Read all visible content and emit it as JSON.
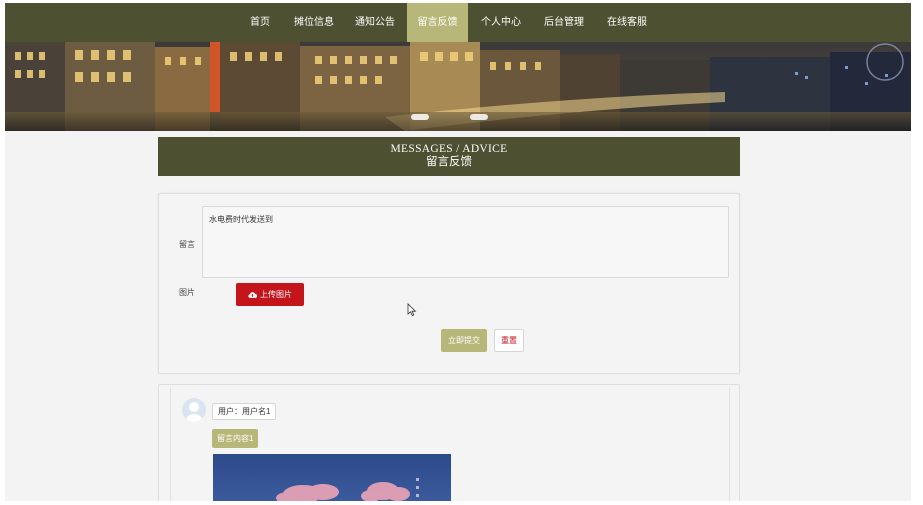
{
  "nav": {
    "items": [
      {
        "label": "首页",
        "active": false
      },
      {
        "label": "摊位信息",
        "active": false
      },
      {
        "label": "通知公告",
        "active": false
      },
      {
        "label": "留言反馈",
        "active": true
      },
      {
        "label": "个人中心",
        "active": false
      },
      {
        "label": "后台管理",
        "active": false
      },
      {
        "label": "在线客服",
        "active": false
      }
    ]
  },
  "banner": {
    "icon": "city-night-banner",
    "slide_count": 2,
    "active_slide": 1
  },
  "section": {
    "title_en": "MESSAGES / ADVICE",
    "title_cn": "留言反馈"
  },
  "form": {
    "message_label": "留言",
    "message_value": "水电费时代发送到",
    "image_label": "图片",
    "upload_label": "上传图片",
    "upload_icon": "cloud-upload-icon",
    "submit_label": "立即提交",
    "reset_label": "重置"
  },
  "messages": [
    {
      "avatar_icon": "user-avatar-icon",
      "user_text": "用户：用户名1",
      "content_text": "留言内容1",
      "image_icon": "sky-photo"
    }
  ],
  "colors": {
    "nav_bg": "#4d5031",
    "accent": "#b7b77a",
    "danger": "#c4141c",
    "page_bg": "#f3f3f3"
  }
}
